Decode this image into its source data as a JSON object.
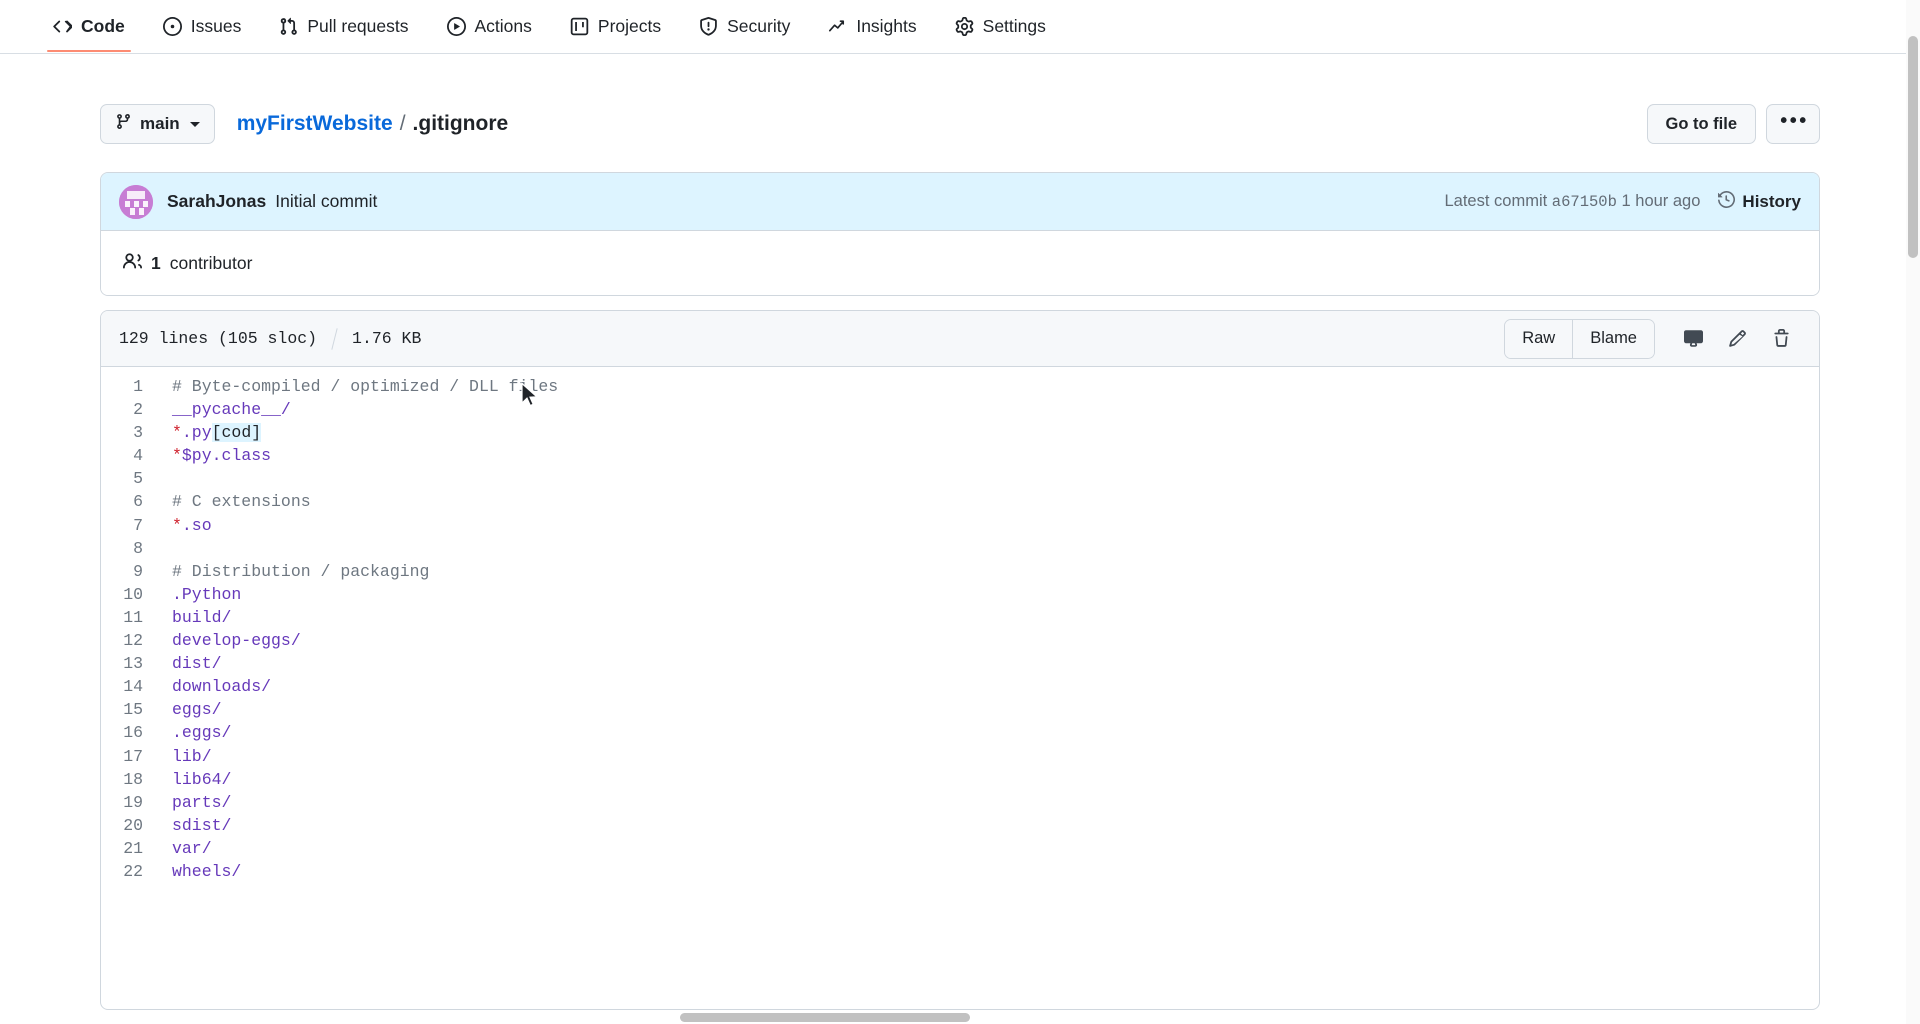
{
  "nav": {
    "items": [
      {
        "label": "Code",
        "icon": "code-icon",
        "active": true
      },
      {
        "label": "Issues",
        "icon": "issue-opened-icon",
        "active": false
      },
      {
        "label": "Pull requests",
        "icon": "git-pull-request-icon",
        "active": false
      },
      {
        "label": "Actions",
        "icon": "play-icon",
        "active": false
      },
      {
        "label": "Projects",
        "icon": "project-icon",
        "active": false
      },
      {
        "label": "Security",
        "icon": "shield-icon",
        "active": false
      },
      {
        "label": "Insights",
        "icon": "graph-icon",
        "active": false
      },
      {
        "label": "Settings",
        "icon": "gear-icon",
        "active": false
      }
    ]
  },
  "breadcrumb": {
    "branch": "main",
    "repo": "myFirstWebsite",
    "separator": "/",
    "file": ".gitignore",
    "go_to_file": "Go to file",
    "more": "•••"
  },
  "commit": {
    "author": "SarahJonas",
    "message": "Initial commit",
    "latest_label": "Latest commit",
    "sha": "a67150b",
    "time": "1 hour ago",
    "history": "History",
    "banner_color": "#ddf4ff"
  },
  "contributors": {
    "count": "1",
    "label": "contributor"
  },
  "file_header": {
    "lines": "129 lines (105 sloc)",
    "size": "1.76 KB",
    "raw": "Raw",
    "blame": "Blame",
    "icons": [
      "desktop-download-icon",
      "pencil-icon",
      "trash-icon"
    ]
  },
  "code_lines": [
    {
      "n": "1",
      "tokens": [
        {
          "t": "# Byte-compiled / optimized / DLL files",
          "c": "c-com"
        }
      ]
    },
    {
      "n": "2",
      "tokens": [
        {
          "t": "__pycache__",
          "c": "c-pat"
        },
        {
          "t": "/",
          "c": "c-pat"
        }
      ]
    },
    {
      "n": "3",
      "tokens": [
        {
          "t": "*",
          "c": "c-star"
        },
        {
          "t": ".py",
          "c": "c-pat"
        },
        {
          "t": "[cod]",
          "c": "c-brk"
        }
      ]
    },
    {
      "n": "4",
      "tokens": [
        {
          "t": "*",
          "c": "c-star"
        },
        {
          "t": "$py.class",
          "c": "c-pat"
        }
      ]
    },
    {
      "n": "5",
      "tokens": []
    },
    {
      "n": "6",
      "tokens": [
        {
          "t": "# C extensions",
          "c": "c-com"
        }
      ]
    },
    {
      "n": "7",
      "tokens": [
        {
          "t": "*",
          "c": "c-star"
        },
        {
          "t": ".so",
          "c": "c-pat"
        }
      ]
    },
    {
      "n": "8",
      "tokens": []
    },
    {
      "n": "9",
      "tokens": [
        {
          "t": "# Distribution / packaging",
          "c": "c-com"
        }
      ]
    },
    {
      "n": "10",
      "tokens": [
        {
          "t": ".Python",
          "c": "c-pat"
        }
      ]
    },
    {
      "n": "11",
      "tokens": [
        {
          "t": "build",
          "c": "c-pat"
        },
        {
          "t": "/",
          "c": "c-pat"
        }
      ]
    },
    {
      "n": "12",
      "tokens": [
        {
          "t": "develop-eggs",
          "c": "c-pat"
        },
        {
          "t": "/",
          "c": "c-pat"
        }
      ]
    },
    {
      "n": "13",
      "tokens": [
        {
          "t": "dist",
          "c": "c-pat"
        },
        {
          "t": "/",
          "c": "c-pat"
        }
      ]
    },
    {
      "n": "14",
      "tokens": [
        {
          "t": "downloads",
          "c": "c-pat"
        },
        {
          "t": "/",
          "c": "c-pat"
        }
      ]
    },
    {
      "n": "15",
      "tokens": [
        {
          "t": "eggs",
          "c": "c-pat"
        },
        {
          "t": "/",
          "c": "c-pat"
        }
      ]
    },
    {
      "n": "16",
      "tokens": [
        {
          "t": ".eggs",
          "c": "c-pat"
        },
        {
          "t": "/",
          "c": "c-pat"
        }
      ]
    },
    {
      "n": "17",
      "tokens": [
        {
          "t": "lib",
          "c": "c-pat"
        },
        {
          "t": "/",
          "c": "c-pat"
        }
      ]
    },
    {
      "n": "18",
      "tokens": [
        {
          "t": "lib64",
          "c": "c-pat"
        },
        {
          "t": "/",
          "c": "c-pat"
        }
      ]
    },
    {
      "n": "19",
      "tokens": [
        {
          "t": "parts",
          "c": "c-pat"
        },
        {
          "t": "/",
          "c": "c-pat"
        }
      ]
    },
    {
      "n": "20",
      "tokens": [
        {
          "t": "sdist",
          "c": "c-pat"
        },
        {
          "t": "/",
          "c": "c-pat"
        }
      ]
    },
    {
      "n": "21",
      "tokens": [
        {
          "t": "var",
          "c": "c-pat"
        },
        {
          "t": "/",
          "c": "c-pat"
        }
      ]
    },
    {
      "n": "22",
      "tokens": [
        {
          "t": "wheels",
          "c": "c-pat"
        },
        {
          "t": "/",
          "c": "c-pat"
        }
      ]
    }
  ],
  "colors": {
    "accent": "#0969da",
    "active_tab_underline": "#fd8c73",
    "commit_banner": "#ddf4ff",
    "border": "#d0d7de",
    "muted_text": "#636c76",
    "comment": "#6e7781",
    "pattern": "#6639ba",
    "star": "#cf222e"
  }
}
